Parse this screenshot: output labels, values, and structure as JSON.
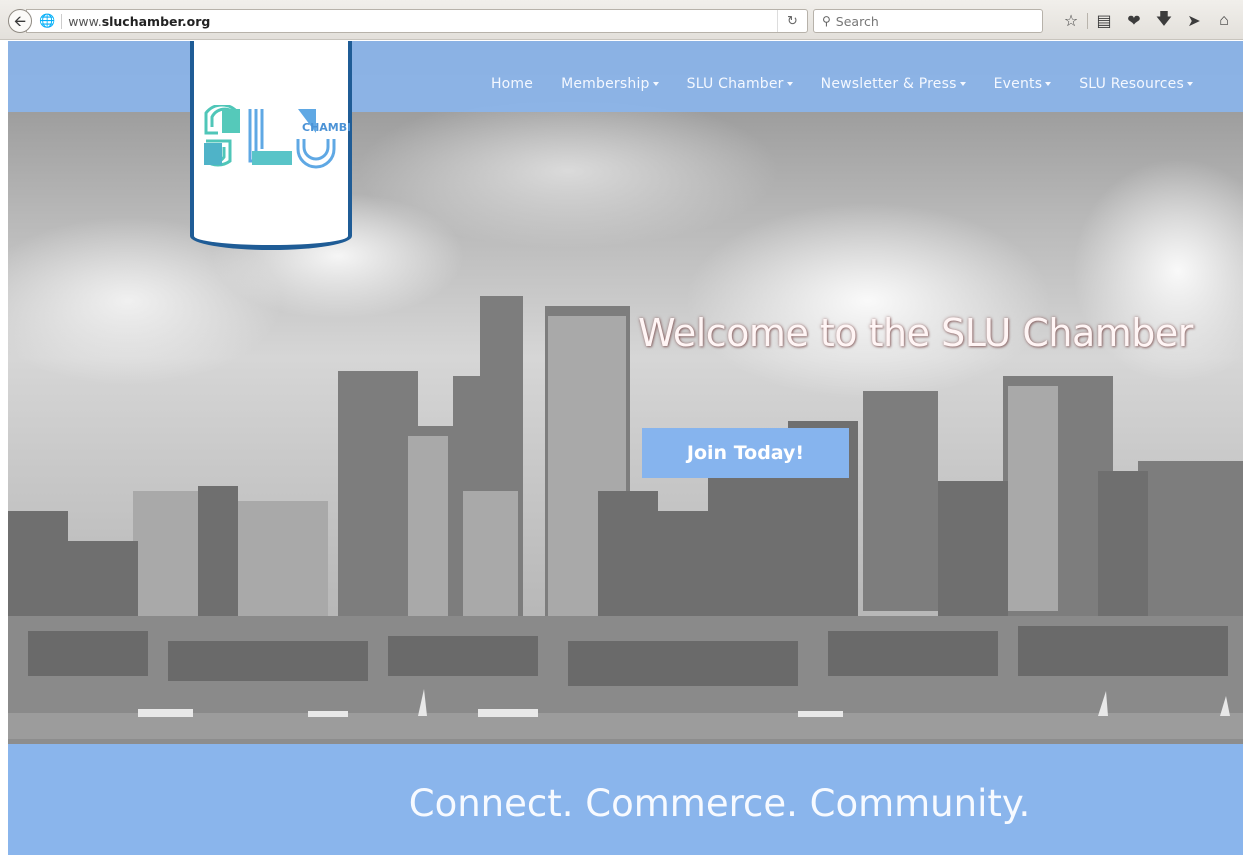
{
  "browser": {
    "url_prefix": "www.",
    "url_domain": "sluchamber.org",
    "search_placeholder": "Search",
    "icons": [
      "back-arrow-icon",
      "globe-icon",
      "reload-icon",
      "search-icon",
      "star-icon",
      "reading-list-icon",
      "pocket-icon",
      "download-icon",
      "send-icon",
      "home-icon"
    ]
  },
  "logo": {
    "letters": "SLU",
    "word": "CHAMBER"
  },
  "nav": {
    "items": [
      {
        "label": "Home",
        "dropdown": false
      },
      {
        "label": "Membership",
        "dropdown": true
      },
      {
        "label": "SLU Chamber",
        "dropdown": true
      },
      {
        "label": "Newsletter & Press",
        "dropdown": true
      },
      {
        "label": "Events",
        "dropdown": true
      },
      {
        "label": "SLU Resources",
        "dropdown": true
      }
    ]
  },
  "hero": {
    "title": "Welcome to the SLU Chamber",
    "cta_label": "Join Today!"
  },
  "tagline": {
    "text": "Connect. Commerce. Community."
  },
  "colors": {
    "nav_bg": "#8bb5eb",
    "button_bg": "#86b4ee",
    "band_bg": "#8ab5ec",
    "badge_border": "#1f5c96",
    "logo_teal": "#4fc6b8",
    "logo_blue": "#5a9fe0"
  }
}
